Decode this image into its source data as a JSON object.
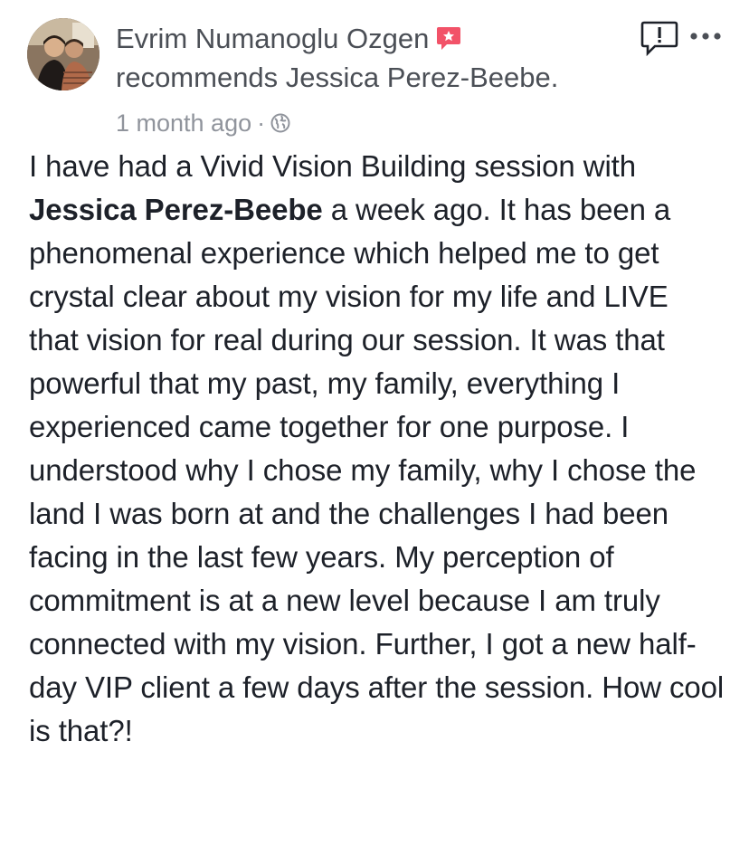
{
  "post": {
    "author": "Evrim Numanoglu Ozgen",
    "recommend_text": "recommends Jessica Perez-Beebe.",
    "timestamp": "1 month ago",
    "separator": "·",
    "privacy_icon": "globe-icon",
    "recommend_icon": "recommendation-badge-icon",
    "report_icon": "report-icon",
    "more_icon": "more-options-icon",
    "body": {
      "part1": "I have had a Vivid Vision Building session with ",
      "mention": "Jessica Perez-Beebe",
      "part2": " a week ago. It has been a phenomenal experience which helped me to get crystal clear about my vision for my life and LIVE that vision for real during our session. It was that powerful that my past, my family, everything I experienced came together for one purpose. I understood why I chose my family, why I chose the land I was born at and the challenges I had been facing in the last few years. My perception of commitment is at a new level because I am truly connected with my vision. Further, I got a new half-day VIP client a few days after the session. How cool is that?!"
    }
  },
  "colors": {
    "text_primary": "#1d2129",
    "text_secondary": "#4b4f56",
    "text_meta": "#90949c",
    "recommend_badge": "#f25268"
  }
}
